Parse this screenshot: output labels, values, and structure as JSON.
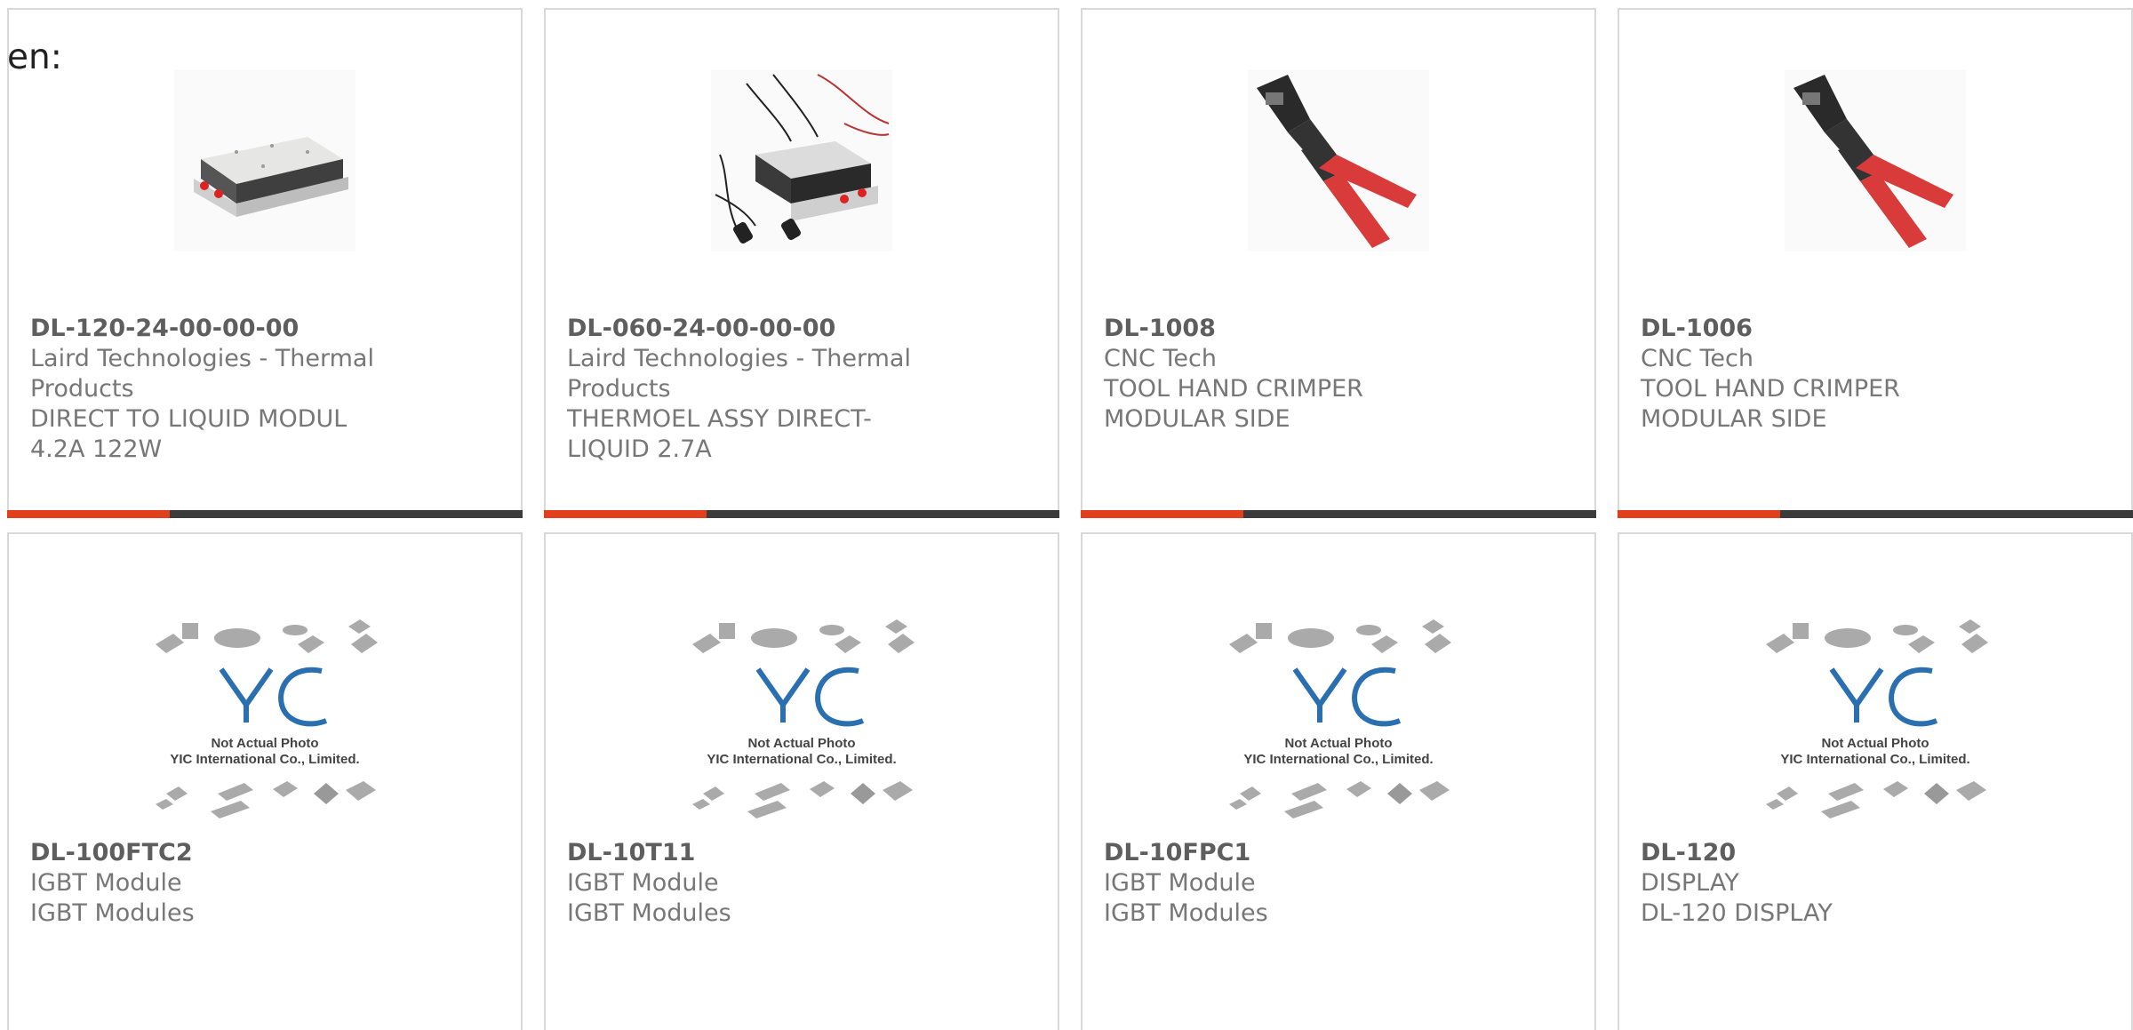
{
  "lang_label": "en:",
  "colors": {
    "accent": "#e2401c",
    "bar": "#3c3c3c",
    "border": "#d9d9d9"
  },
  "placeholder": {
    "line1": "Not Actual Photo",
    "line2": "YIC International Co., Limited."
  },
  "products": [
    {
      "part": "DL-120-24-00-00-00",
      "maker": "Laird Technologies - Thermal Products",
      "desc": "DIRECT TO LIQUID MODUL 4.2A 122W",
      "image": "thermal-module"
    },
    {
      "part": "DL-060-24-00-00-00",
      "maker": "Laird Technologies - Thermal Products",
      "desc": "THERMOEL ASSY DIRECT-LIQUID 2.7A",
      "image": "thermal-assembly"
    },
    {
      "part": "DL-1008",
      "maker": "CNC Tech",
      "desc": "TOOL HAND CRIMPER MODULAR SIDE",
      "image": "crimper"
    },
    {
      "part": "DL-1006",
      "maker": "CNC Tech",
      "desc": "TOOL HAND CRIMPER MODULAR SIDE",
      "image": "crimper"
    },
    {
      "part": "DL-100FTC2",
      "maker": "IGBT Module",
      "desc": "IGBT Modules",
      "image": "placeholder"
    },
    {
      "part": "DL-10T11",
      "maker": "IGBT Module",
      "desc": "IGBT Modules",
      "image": "placeholder"
    },
    {
      "part": "DL-10FPC1",
      "maker": "IGBT Module",
      "desc": "IGBT Modules",
      "image": "placeholder"
    },
    {
      "part": "DL-120",
      "maker": "DISPLAY",
      "desc": "DL-120 DISPLAY",
      "image": "placeholder"
    }
  ]
}
